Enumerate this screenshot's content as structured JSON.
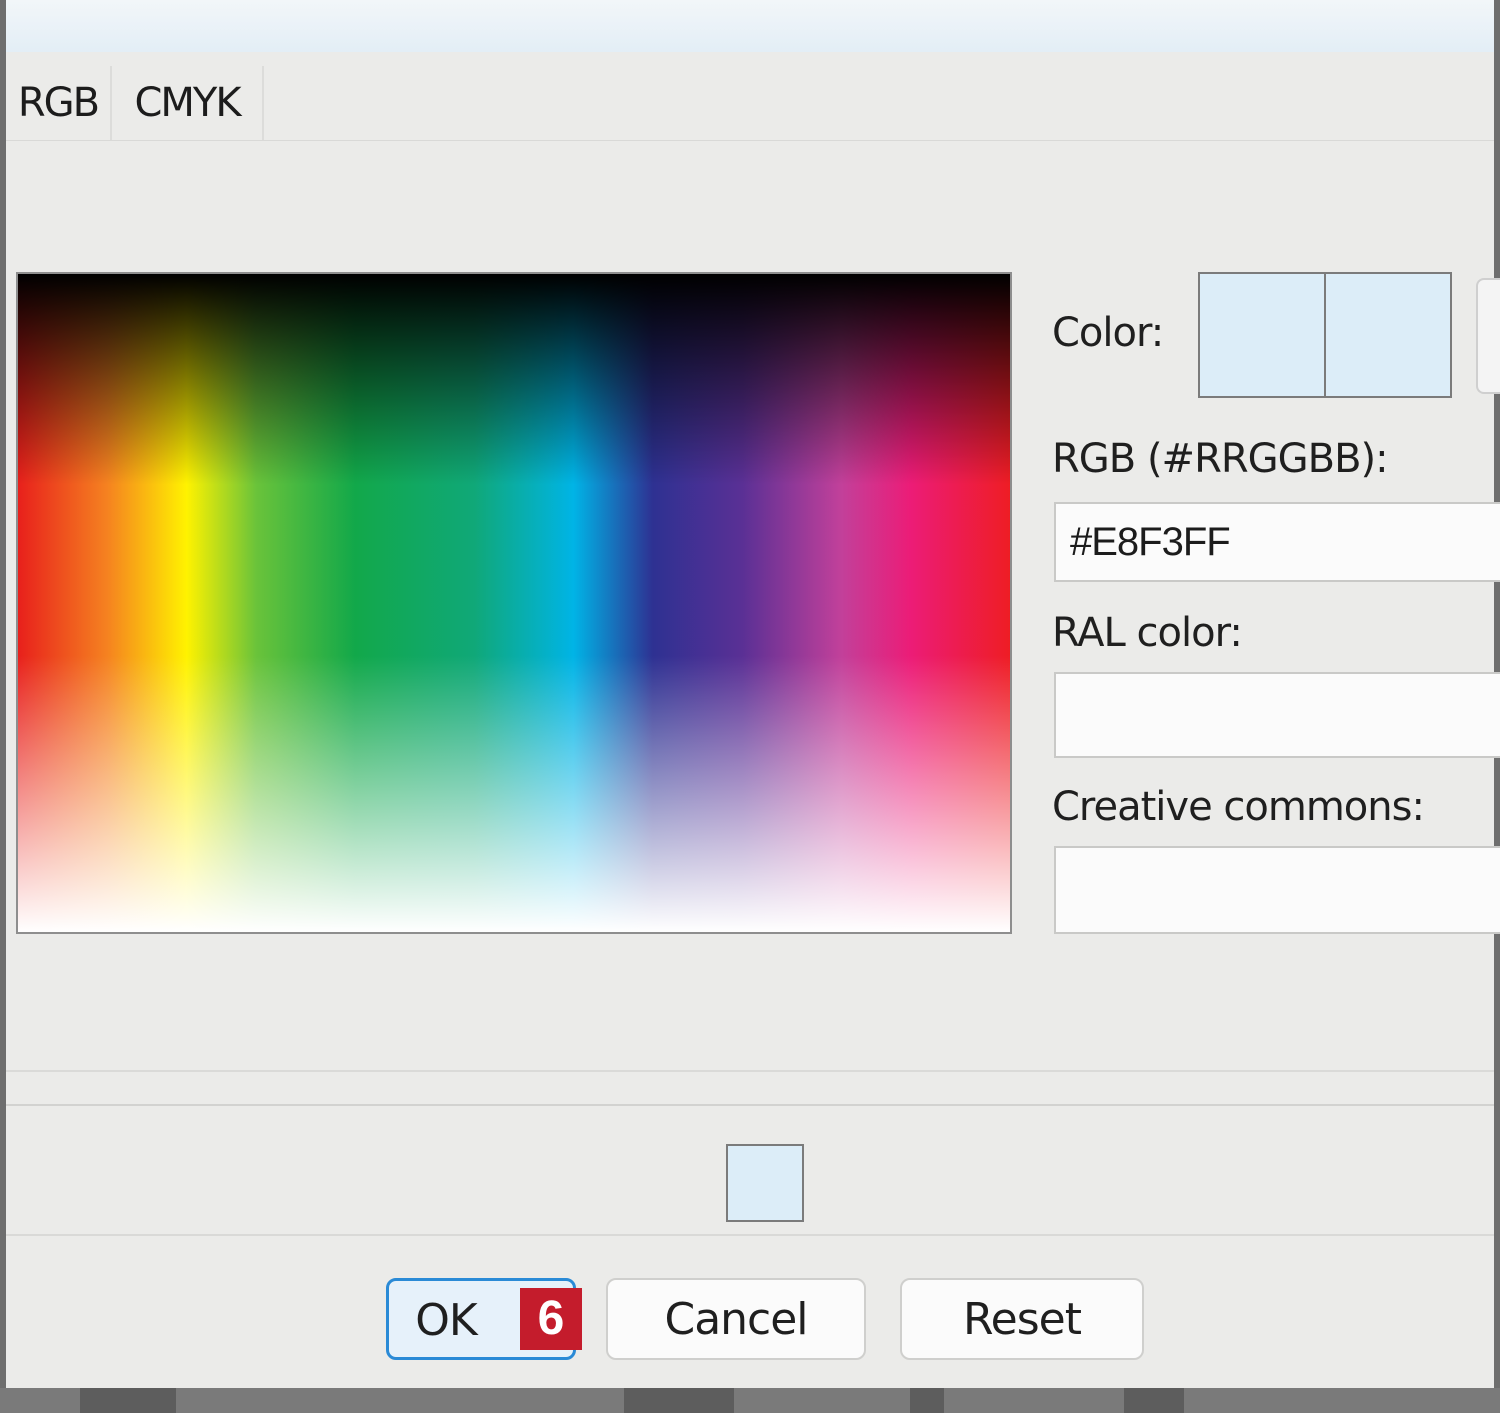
{
  "tabs": [
    {
      "label": "RGB"
    },
    {
      "label": "CMYK"
    }
  ],
  "fields": {
    "color_label": "Color:",
    "rgb_label": "RGB (#RRGGBB):",
    "rgb_value": "#E8F3FF",
    "ral_label": "RAL color:",
    "ral_value": "",
    "cc_label": "Creative commons:",
    "cc_value": ""
  },
  "buttons": {
    "ok": "OK",
    "cancel": "Cancel",
    "reset": "Reset"
  },
  "annotation": {
    "badge": "6"
  },
  "colors": {
    "current_color": "#dcedf8",
    "accent": "#2a8ad6",
    "badge": "#c41c2c"
  }
}
